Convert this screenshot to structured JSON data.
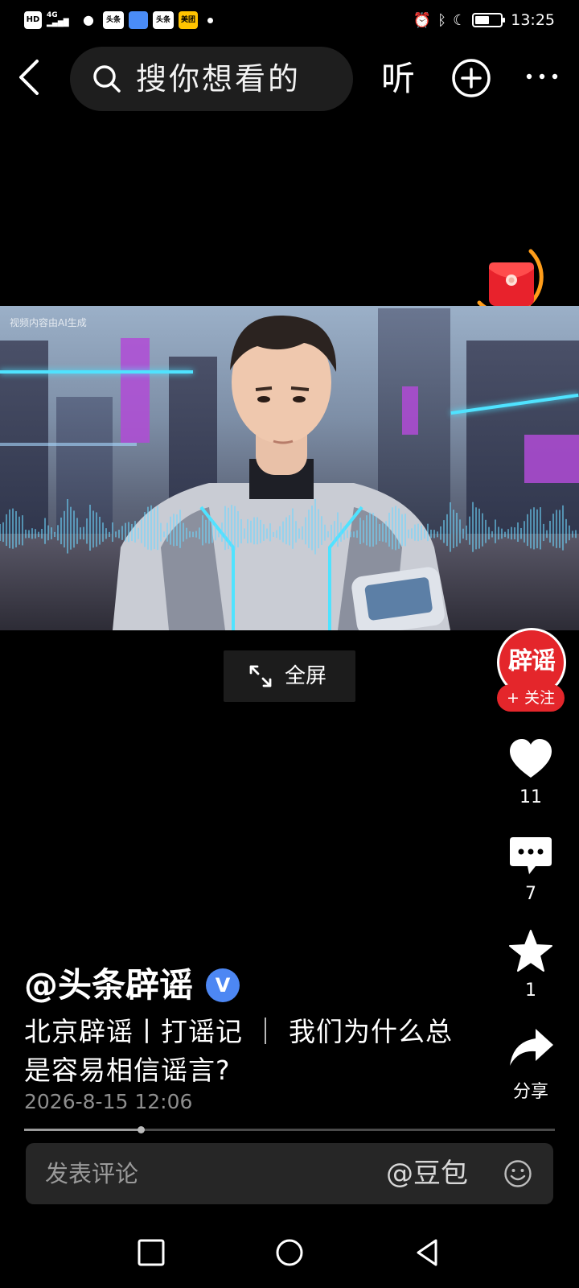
{
  "status_bar": {
    "left_chips": [
      "HD",
      "4G",
      "头条",
      "头条",
      "美团"
    ],
    "time": "13:25",
    "battery_level": 0.55
  },
  "top_bar": {
    "search_placeholder": "搜你想看的",
    "listen_label": "听"
  },
  "video": {
    "ai_notice": "视频内容由AI生成",
    "fullscreen_label": "全屏"
  },
  "author": {
    "avatar_text": "辟谣",
    "follow_label": "+ 关注",
    "handle": "@头条辟谣",
    "verified_mark": "V"
  },
  "actions": {
    "likes": "11",
    "comments": "7",
    "favorites": "1",
    "share_label": "分享"
  },
  "post": {
    "title": "北京辟谣丨打谣记 ｜ 我们为什么总是容易相信谣言?",
    "date": "2026-8-15 12:06"
  },
  "playback": {
    "progress": 0.22
  },
  "comment_bar": {
    "placeholder": "发表评论",
    "doubao_label": "@豆包"
  },
  "colors": {
    "brand_red": "#e4262b",
    "verified_blue": "#4d87f3",
    "background": "#000000"
  },
  "icons": [
    "back-arrow-icon",
    "search-icon",
    "add-circle-icon",
    "more-dots-icon",
    "red-envelope-icon",
    "expand-icon",
    "heart-icon",
    "comment-icon",
    "star-icon",
    "share-icon",
    "smiley-icon",
    "square-icon",
    "circle-icon",
    "triangle-back-icon"
  ]
}
